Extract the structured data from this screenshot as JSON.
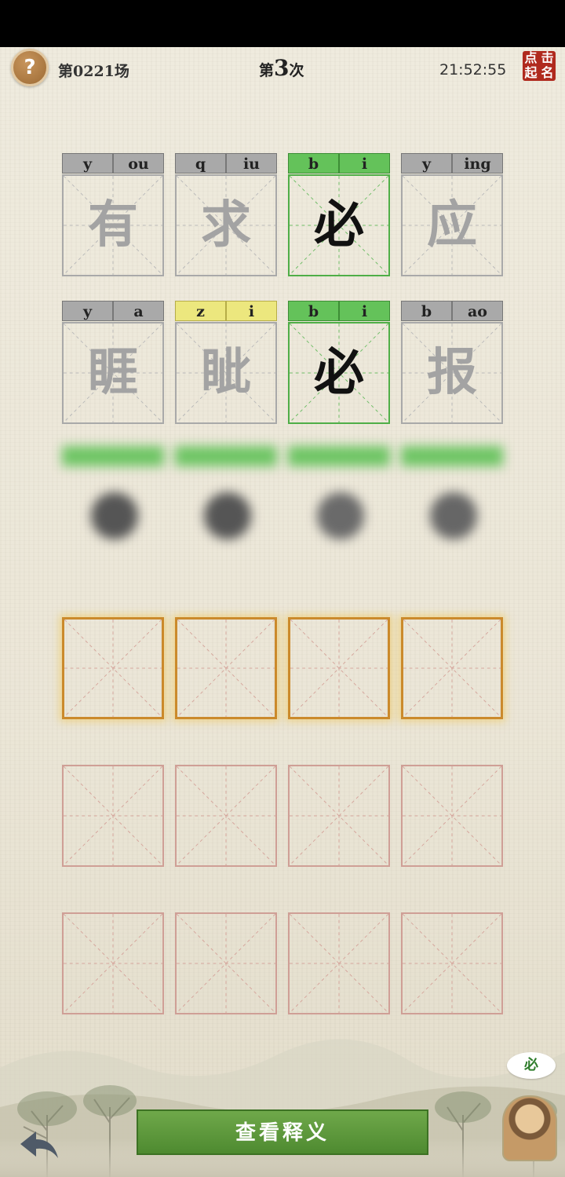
{
  "header": {
    "help": "?",
    "round": "第0221场",
    "attempt_prefix": "第",
    "attempt_number": "3",
    "attempt_suffix": "次",
    "clock": "21:52:55",
    "seal": [
      "点",
      "击",
      "起",
      "名"
    ]
  },
  "guesses": [
    [
      {
        "pinyin": [
          "y",
          "ou"
        ],
        "char": "有",
        "status": "gray"
      },
      {
        "pinyin": [
          "q",
          "iu"
        ],
        "char": "求",
        "status": "gray"
      },
      {
        "pinyin": [
          "b",
          "i"
        ],
        "char": "必",
        "status": "green"
      },
      {
        "pinyin": [
          "y",
          "ing"
        ],
        "char": "应",
        "status": "gray"
      }
    ],
    [
      {
        "pinyin": [
          "y",
          "a"
        ],
        "char": "睚",
        "status": "gray"
      },
      {
        "pinyin": [
          "z",
          "i"
        ],
        "char": "眦",
        "status": "yellow"
      },
      {
        "pinyin": [
          "b",
          "i"
        ],
        "char": "必",
        "status": "green"
      },
      {
        "pinyin": [
          "b",
          "ao"
        ],
        "char": "报",
        "status": "gray"
      }
    ]
  ],
  "view_button": "查看释义",
  "hint_bubble": "必"
}
